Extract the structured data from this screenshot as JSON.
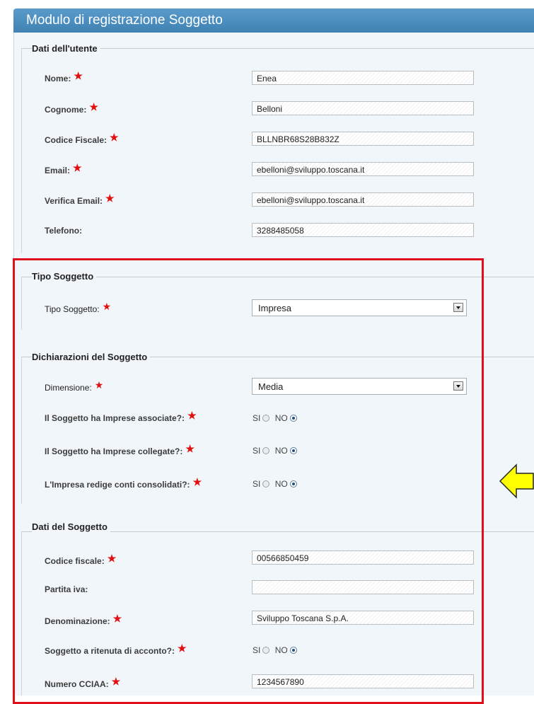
{
  "header": {
    "title": "Modulo di registrazione Soggetto"
  },
  "sections": {
    "utente": {
      "legend": "Dati dell'utente",
      "fields": {
        "nome": {
          "label": "Nome:",
          "value": "Enea"
        },
        "cognome": {
          "label": "Cognome:",
          "value": "Belloni"
        },
        "codice_fiscale": {
          "label": "Codice Fiscale:",
          "value": "BLLNBR68S28B832Z"
        },
        "email": {
          "label": "Email:",
          "value": "ebelloni@sviluppo.toscana.it"
        },
        "verifica_email": {
          "label": "Verifica Email:",
          "value": "ebelloni@sviluppo.toscana.it"
        },
        "telefono": {
          "label": "Telefono:",
          "value": "3288485058"
        }
      }
    },
    "tipo": {
      "legend": "Tipo Soggetto",
      "fields": {
        "tipo_soggetto": {
          "label": "Tipo Soggetto:",
          "value": "Impresa"
        }
      }
    },
    "dichiarazioni": {
      "legend": "Dichiarazioni del Soggetto",
      "fields": {
        "dimensione": {
          "label": "Dimensione:",
          "value": "Media"
        },
        "associate": {
          "label": "Il Soggetto ha Imprese associate?:",
          "yes": "SI",
          "no": "NO",
          "selected": "NO"
        },
        "collegate": {
          "label": "Il Soggetto ha Imprese collegate?:",
          "yes": "SI",
          "no": "NO",
          "selected": "NO"
        },
        "consolidati": {
          "label": "L'Impresa redige conti consolidati?:",
          "yes": "SI",
          "no": "NO",
          "selected": "NO"
        }
      }
    },
    "soggetto": {
      "legend": "Dati del Soggetto",
      "fields": {
        "codice_fiscale": {
          "label": "Codice fiscale:",
          "value": "00566850459"
        },
        "partita_iva": {
          "label": "Partita iva:",
          "value": ""
        },
        "denominazione": {
          "label": "Denominazione:",
          "value": "Sviluppo Toscana S.p.A."
        },
        "ritenuta": {
          "label": "Soggetto a ritenuta di acconto?:",
          "yes": "SI",
          "no": "NO",
          "selected": "NO"
        },
        "cciaa": {
          "label": "Numero CCIAA:",
          "value": "1234567890"
        }
      }
    }
  },
  "required_marker": "★",
  "colors": {
    "header_bg": "#4a8dbd",
    "panel_bg": "#f1f6fa",
    "highlight_border": "#e0101a",
    "arrow_fill": "#ffff00",
    "required_star": "#e01010"
  },
  "annotations": {
    "arrow_icon": "left-arrow-icon"
  }
}
